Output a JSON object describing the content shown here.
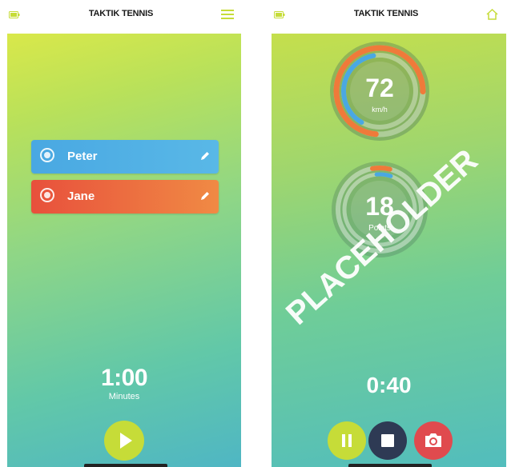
{
  "app": {
    "title": "TAKTIK TENNIS"
  },
  "setup_screen": {
    "players": [
      {
        "name": "Peter",
        "color": "#4aa8e2"
      },
      {
        "name": "Jane",
        "color": "#e8503c"
      }
    ],
    "timer": {
      "value": "1:00",
      "unit": "Minutes"
    },
    "icons": [
      "battery-icon",
      "menu-icon",
      "edit-icon",
      "play-icon"
    ]
  },
  "match_screen": {
    "speed": {
      "value": "72",
      "unit": "km/h"
    },
    "points": {
      "value": "18",
      "label": "Points"
    },
    "timer": {
      "value": "0:40"
    },
    "watermark": "PLACEHOLDER",
    "icons": [
      "battery-icon",
      "home-icon",
      "pause-icon",
      "stop-icon",
      "camera-icon"
    ]
  },
  "colors": {
    "accent_lime": "#c6dc38",
    "blue": "#4aa8e2",
    "red": "#e8503c",
    "orange": "#ef7a3a",
    "navy": "#2e3a54"
  }
}
